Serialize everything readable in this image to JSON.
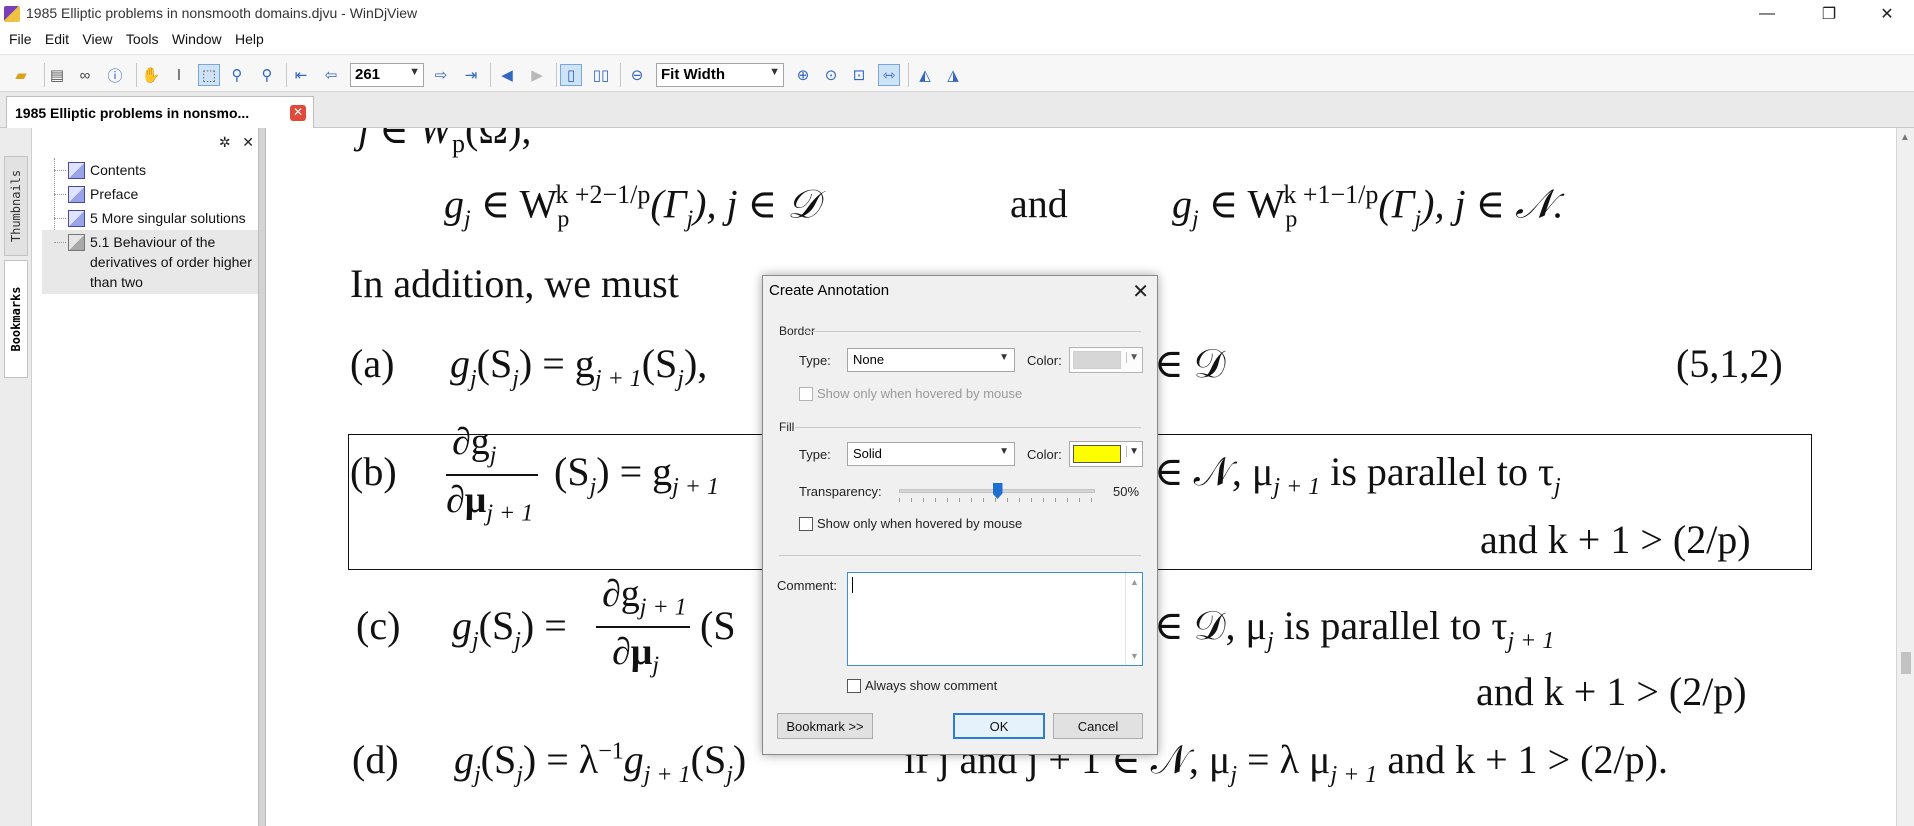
{
  "window": {
    "title": "1985 Elliptic problems in nonsmooth domains.djvu - WinDjView",
    "minimize": "—",
    "restore": "❐",
    "close": "✕"
  },
  "menu": [
    "File",
    "Edit",
    "View",
    "Tools",
    "Window",
    "Help"
  ],
  "toolbar": {
    "page_number": "261",
    "zoom": "Fit Width"
  },
  "tab": {
    "label": "1985 Elliptic problems in nonsmo...",
    "close": "✕"
  },
  "side_tabs": {
    "thumbnails": "Thumbnails",
    "bookmarks": "Bookmarks"
  },
  "bookmarks": {
    "header_icons": {
      "settings": "✲",
      "close": "✕"
    },
    "items": [
      {
        "label": "Contents"
      },
      {
        "label": "Preface"
      },
      {
        "label": "5 More singular solutions"
      },
      {
        "label": "5.1 Behaviour of the derivatives of order higher than two"
      }
    ]
  },
  "page": {
    "line_top": "j ∈ W",
    "line1_left": "g",
    "line1_a": "∈ W",
    "line1_and": "and",
    "line1_right": "∈ W",
    "line1_sup1": "k +2−1/p",
    "line1_sup2": "k +1−1/p",
    "line1_tail1": "(Γ",
    "line1_tail1b": "),    j ∈ 𝒟",
    "line1_tail2b": "),    j ∈ 𝒩.",
    "intro": "In addition, we must",
    "a_label": "(a)",
    "a_eq": "g",
    "a_rest": "(S",
    "a_rest2": ") = g",
    "a_rest3": "(S",
    "a_rest4": "),",
    "a_right": "∈ 𝒟",
    "a_num": "(5,1,2)",
    "b_label": "(b)",
    "b_num": "∂g",
    "b_den": "∂μ",
    "b_mid": "(S",
    "b_mid2": ") = g",
    "b_right": "∈ 𝒩, μ",
    "b_right2": "is parallel to τ",
    "b_line2": "and k + 1 > (2/p)",
    "c_label": "(c)",
    "c_eq": "g",
    "c_eq2": "(S",
    "c_eq3": ") =",
    "c_num": "∂g",
    "c_den": "∂μ",
    "c_mid": "(S",
    "c_right": "∈ 𝒟, μ",
    "c_right2": "is parallel to τ",
    "c_line2": "and k + 1 > (2/p)",
    "d_label": "(d)",
    "d_eq": "g",
    "d_eq2": "(S",
    "d_eq3": ") = λ",
    "d_eq4": "g",
    "d_eq5": "(S",
    "d_eq6": ")",
    "d_right": "if j and j + 1 ∈ 𝒩, μ",
    "d_right2": "= λ μ",
    "d_right3": "and k + 1 > (2/p).",
    "sub_j": "j",
    "sub_j1": "j + 1",
    "sub_p": "p",
    "sup_m1": "−1"
  },
  "dialog": {
    "title": "Create Annotation",
    "close": "✕",
    "border_group": "Border",
    "border_type_label": "Type:",
    "border_type_value": "None",
    "border_color_label": "Color:",
    "border_color": "#d0d0d0",
    "border_hover": "Show only when hovered by mouse",
    "fill_group": "Fill",
    "fill_type_label": "Type:",
    "fill_type_value": "Solid",
    "fill_color_label": "Color:",
    "fill_color": "#ffff00",
    "transparency_label": "Transparency:",
    "transparency_value": "50%",
    "transparency": 0.5,
    "fill_hover": "Show only when hovered by mouse",
    "comment_label": "Comment:",
    "comment_value": "",
    "always_show": "Always show comment",
    "bookmark_btn": "Bookmark >>",
    "ok_btn": "OK",
    "cancel_btn": "Cancel"
  }
}
